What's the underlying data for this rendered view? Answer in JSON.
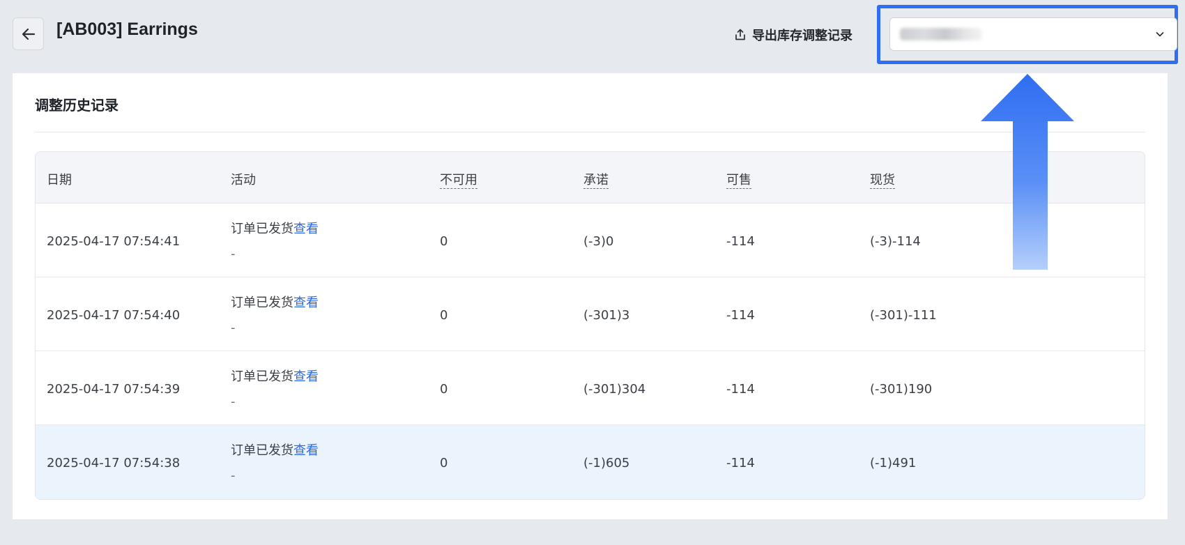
{
  "header": {
    "title": "[AB003] Earrings",
    "export_label": "导出库存调整记录",
    "store_select": {
      "selected_value": "██████████"
    }
  },
  "card": {
    "title": "调整历史记录"
  },
  "table": {
    "columns": [
      "日期",
      "活动",
      "不可用",
      "承诺",
      "可售",
      "现货"
    ],
    "rows": [
      {
        "date": "2025-04-17 07:54:41",
        "activity": "订单已发货",
        "link": "查看",
        "note": "-",
        "unavailable": "0",
        "committed": "(-3)0",
        "available": "-114",
        "on_hand": "(-3)-114"
      },
      {
        "date": "2025-04-17 07:54:40",
        "activity": "订单已发货",
        "link": "查看",
        "note": "-",
        "unavailable": "0",
        "committed": "(-301)3",
        "available": "-114",
        "on_hand": "(-301)-111"
      },
      {
        "date": "2025-04-17 07:54:39",
        "activity": "订单已发货",
        "link": "查看",
        "note": "-",
        "unavailable": "0",
        "committed": "(-301)304",
        "available": "-114",
        "on_hand": "(-301)190"
      },
      {
        "date": "2025-04-17 07:54:38",
        "activity": "订单已发货",
        "link": "查看",
        "note": "-",
        "unavailable": "0",
        "committed": "(-1)605",
        "available": "-114",
        "on_hand": "(-1)491"
      }
    ]
  },
  "colors": {
    "highlight": "#2f6ef2",
    "link": "#2d6ae0",
    "hovered_row": "#ebf3fd",
    "page_background": "#e6e9ee"
  },
  "icons": {
    "back": "arrow-left-icon",
    "export": "export-icon",
    "select": "chevron-down-icon",
    "annotation": "up-arrow-annotation"
  }
}
